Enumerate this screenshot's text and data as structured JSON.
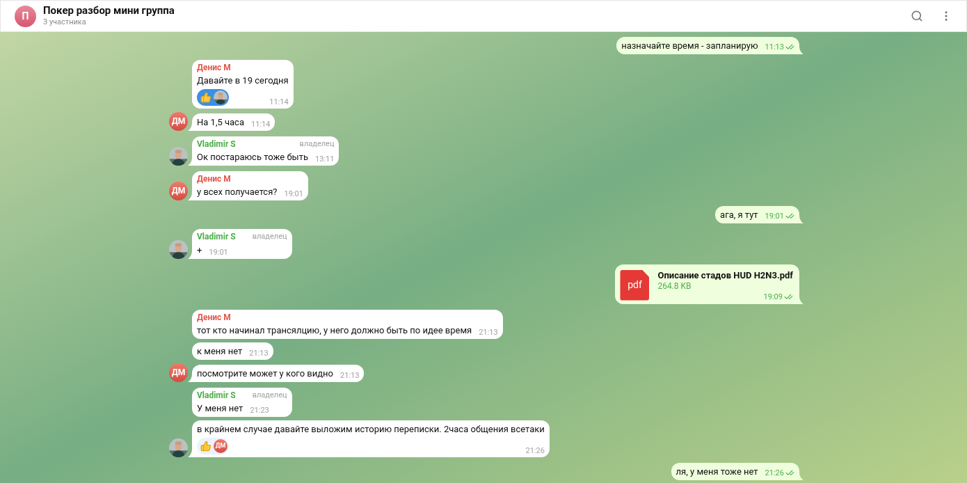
{
  "header": {
    "avatar_letter": "П",
    "title": "Покер разбор мини группа",
    "subtitle": "3 участника"
  },
  "messages": [
    {
      "kind": "out",
      "text": "назначайте время - запланирую",
      "time": "11:13",
      "read": true
    },
    {
      "kind": "in",
      "sender": {
        "name": "Денис М",
        "color": "#e0574a"
      },
      "text": "Давайте в 19 сегодня",
      "time": "11:14",
      "reactions": [
        {
          "selected": true
        }
      ]
    },
    {
      "kind": "in",
      "text": "На 1,5 часа",
      "time": "11:14",
      "avatar": {
        "kind": "initials",
        "text": "ДМ"
      }
    },
    {
      "kind": "in",
      "sender": {
        "name": "Vladimir S",
        "color": "#4cad46"
      },
      "role": "владелец",
      "text": "Ок постараюсь тоже быть",
      "time": "13:11"
    },
    {
      "kind": "in",
      "sender": {
        "name": "Денис М",
        "color": "#e0574a"
      },
      "text": "у всех получается?",
      "time": "19:01",
      "avatar": {
        "kind": "initials",
        "text": "ДМ"
      }
    },
    {
      "kind": "out",
      "text": "ага, я тут",
      "time": "19:01",
      "read": true
    },
    {
      "kind": "in",
      "sender": {
        "name": "Vladimir S",
        "color": "#4cad46"
      },
      "role": "владелец",
      "text": "+",
      "time": "19:01"
    },
    {
      "kind": "out",
      "file": {
        "icon": "pdf",
        "name": "Описание стадов HUD H2N3.pdf",
        "size": "264.8 KB"
      },
      "time": "19:09",
      "read": true
    },
    {
      "kind": "in",
      "sender": {
        "name": "Денис М",
        "color": "#e0574a"
      },
      "text": "тот кто начинал трансялцию, у него должно быть по идее время",
      "time": "21:13"
    },
    {
      "kind": "in",
      "text": "к меня нет",
      "time": "21:13"
    },
    {
      "kind": "in",
      "text": "посмотрите может у кого видно",
      "time": "21:13",
      "avatar": {
        "kind": "initials",
        "text": "ДМ"
      }
    },
    {
      "kind": "in",
      "sender": {
        "name": "Vladimir S",
        "color": "#4cad46"
      },
      "role": "владелец",
      "text": "У меня нет",
      "time": "21:23"
    },
    {
      "kind": "in",
      "text": "в крайнем случае давайте выложим историю переписки. 2часа общения всетаки",
      "time": "21:26",
      "reactions": [
        {
          "selected": false,
          "users": [
            {
              "kind": "initials",
              "text": "ДМ"
            }
          ]
        }
      ]
    },
    {
      "kind": "out",
      "text": "ля, у меня тоже нет",
      "time": "21:26",
      "read": true
    }
  ]
}
